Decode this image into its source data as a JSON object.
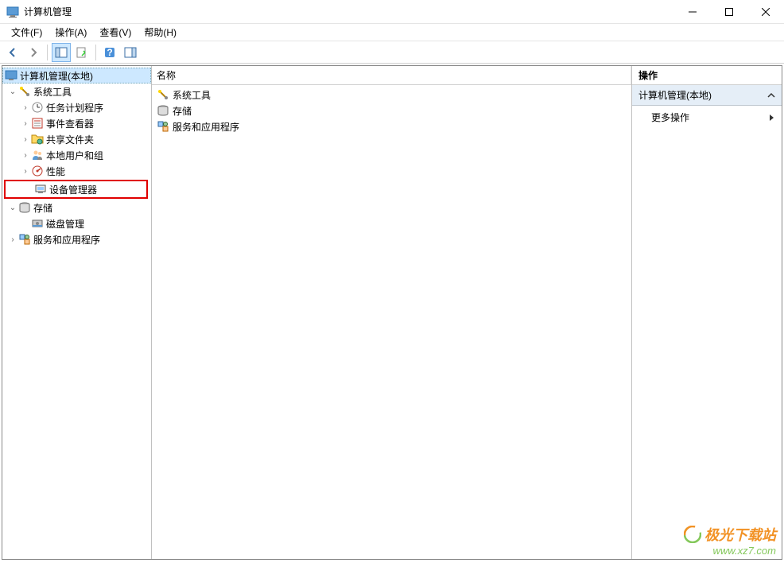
{
  "window": {
    "title": "计算机管理"
  },
  "menu": {
    "file": "文件(F)",
    "action": "操作(A)",
    "view": "查看(V)",
    "help": "帮助(H)"
  },
  "tree": {
    "root": "计算机管理(本地)",
    "system_tools": "系统工具",
    "task_scheduler": "任务计划程序",
    "event_viewer": "事件查看器",
    "shared_folders": "共享文件夹",
    "local_users": "本地用户和组",
    "performance": "性能",
    "device_manager": "设备管理器",
    "storage": "存储",
    "disk_management": "磁盘管理",
    "services_apps": "服务和应用程序"
  },
  "list": {
    "header_name": "名称",
    "items": {
      "system_tools": "系统工具",
      "storage": "存储",
      "services_apps": "服务和应用程序"
    }
  },
  "actions": {
    "header": "操作",
    "section_title": "计算机管理(本地)",
    "more_actions": "更多操作"
  },
  "watermark": {
    "name": "极光下载站",
    "url": "www.xz7.com"
  }
}
